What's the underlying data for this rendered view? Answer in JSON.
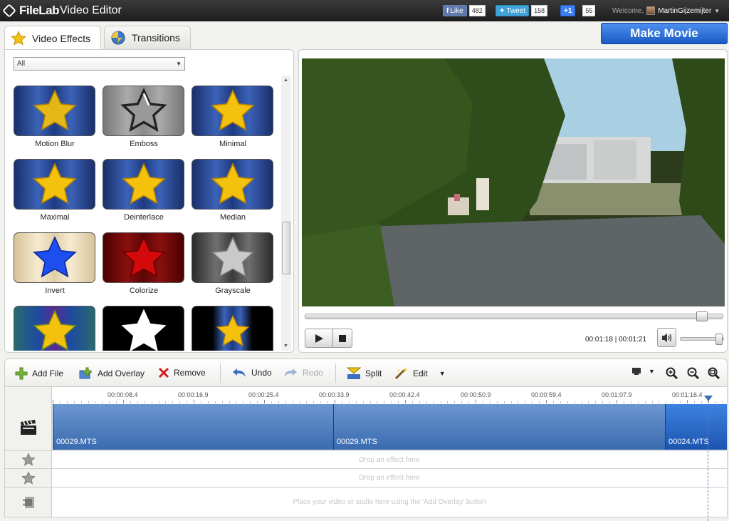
{
  "header": {
    "logo": "FileLab",
    "title": "Video Editor",
    "facebook": {
      "label": "Like",
      "count": "482"
    },
    "twitter": {
      "label": "Tweet",
      "count": "158"
    },
    "gplus": {
      "label": "+1",
      "count": "55"
    },
    "welcome": "Welcome,",
    "user": "MartinGijzemijter",
    "make_movie": "Make Movie"
  },
  "tabs": [
    {
      "label": "Video Effects",
      "icon": "star-icon",
      "active": true
    },
    {
      "label": "Transitions",
      "icon": "transition-ball-icon",
      "active": false
    }
  ],
  "filter": {
    "value": "All"
  },
  "effects": [
    {
      "label": "Motion Blur"
    },
    {
      "label": "Emboss"
    },
    {
      "label": "Minimal"
    },
    {
      "label": "Maximal"
    },
    {
      "label": "Deinterlace"
    },
    {
      "label": "Median"
    },
    {
      "label": "Invert"
    },
    {
      "label": "Colorize"
    },
    {
      "label": "Grayscale"
    },
    {
      "label": ""
    },
    {
      "label": ""
    },
    {
      "label": ""
    }
  ],
  "player": {
    "time": "00:01:18 | 00:01:21",
    "progress": 0.96,
    "volume": 0.95
  },
  "toolbar": {
    "add_file": "Add File",
    "add_overlay": "Add Overlay",
    "remove": "Remove",
    "undo": "Undo",
    "redo": "Redo",
    "split": "Split",
    "edit": "Edit"
  },
  "ruler": [
    "00:00:08.4",
    "00:00:16.9",
    "00:00:25.4",
    "00:00:33.9",
    "00:00:42.4",
    "00:00:50.9",
    "00:00:59.4",
    "00:01:07.9",
    "00:01:16.4"
  ],
  "clips": [
    {
      "name": "00029.MTS"
    },
    {
      "name": "00029.MTS"
    },
    {
      "name": "00024.MTS"
    }
  ],
  "tracks": {
    "effect_hint": "Drop an effect here",
    "overlay_hint": "Place your video or audio here using the 'Add Overlay' button"
  },
  "colors": {
    "accent": "#1a5bc4",
    "clip": "#3a6bb0",
    "star": "#f2c200"
  }
}
